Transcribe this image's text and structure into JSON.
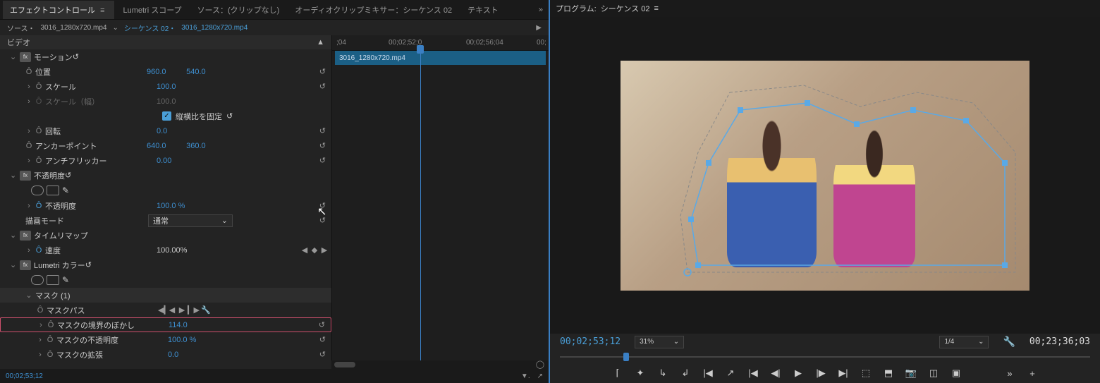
{
  "tabs": {
    "effect_controls": "エフェクトコントロール",
    "lumetri_scopes": "Lumetri スコープ",
    "source_none": "ソース：(クリップなし)",
    "audio_mixer": "オーディオクリップミキサー：シーケンス 02",
    "text": "テキスト"
  },
  "source_line": {
    "prefix": "ソース・",
    "clip": "3016_1280x720.mp4",
    "seq_label": "シーケンス 02・",
    "clip2": "3016_1280x720.mp4"
  },
  "section_video": "ビデオ",
  "props": {
    "motion": "モーション",
    "position": "位置",
    "position_x": "960.0",
    "position_y": "540.0",
    "scale": "スケール",
    "scale_v": "100.0",
    "scale_w": "スケール（幅）",
    "scale_w_v": "100.0",
    "lock_aspect": "縦横比を固定",
    "rotation": "回転",
    "rotation_v": "0.0",
    "anchor": "アンカーポイント",
    "anchor_x": "640.0",
    "anchor_y": "360.0",
    "antiflicker": "アンチフリッカー",
    "antiflicker_v": "0.00",
    "opacity": "不透明度",
    "opacity_v": "100.0 %",
    "blend": "描画モード",
    "blend_v": "通常",
    "timeremap": "タイムリマップ",
    "speed": "速度",
    "speed_v": "100.00%",
    "lumetri": "Lumetri カラー",
    "mask1": "マスク (1)",
    "maskpath": "マスクパス",
    "maskfeather": "マスクの境界のぼかし",
    "maskfeather_v": "114.0",
    "maskopacity": "マスクの不透明度",
    "maskopacity_v": "100.0 %",
    "maskexp": "マスクの拡張",
    "maskexp_v": "0.0"
  },
  "fx": "fx",
  "mini_timeline": {
    "t1": ";04",
    "t2": "00;02;52;0",
    "t3": "00;02;56;04",
    "t4": "00;",
    "clip_name": "3016_1280x720.mp4"
  },
  "footer_tc": "00;02;53;12",
  "program": {
    "label": "プログラム:",
    "seq": "シーケンス 02",
    "tc_left": "00;02;53;12",
    "zoom": "31%",
    "res": "1/4",
    "tc_right": "00;23;36;03"
  },
  "icons": {
    "menu": "≡",
    "chev_r": "›",
    "chev_d": "⌄",
    "stopwatch": "Ô",
    "reset": "↺",
    "diamond": "◆",
    "tri_l": "◀",
    "tri_r": "▶",
    "play": "▶",
    "wrench": "🔧",
    "more": "»",
    "plus": "+",
    "check": "✓",
    "dd": "⌄",
    "circle": "◯",
    "tri_play": "▶"
  }
}
